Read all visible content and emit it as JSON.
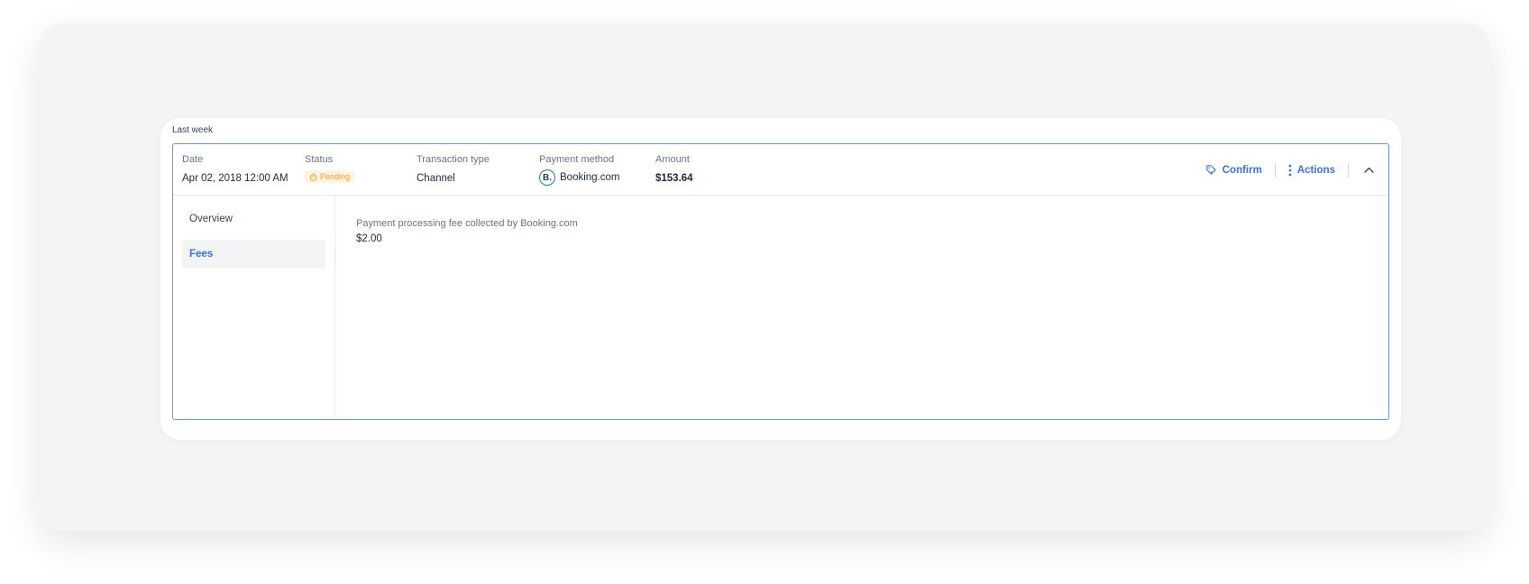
{
  "group": {
    "label": "Last week"
  },
  "transaction": {
    "date": {
      "label": "Date",
      "value": "Apr 02, 2018 12:00 AM"
    },
    "status": {
      "label": "Status",
      "value": "Pending",
      "color": "#f39c2b",
      "bg": "#fff4e0"
    },
    "type": {
      "label": "Transaction type",
      "value": "Channel"
    },
    "payment_method": {
      "label": "Payment method",
      "logo_letter": "B.",
      "value": "Booking.com"
    },
    "amount": {
      "label": "Amount",
      "value": "$153.64"
    }
  },
  "actions": {
    "confirm_label": "Confirm",
    "actions_label": "Actions",
    "accent": "#3b6fe6",
    "icons": [
      "tag-check-icon",
      "kebab-menu-icon",
      "chevron-up-icon"
    ]
  },
  "sidebar": {
    "items": [
      {
        "label": "Overview",
        "active": false
      },
      {
        "label": "Fees",
        "active": true
      }
    ]
  },
  "fees": {
    "label": "Payment processing fee collected by Booking.com",
    "value": "$2.00"
  }
}
